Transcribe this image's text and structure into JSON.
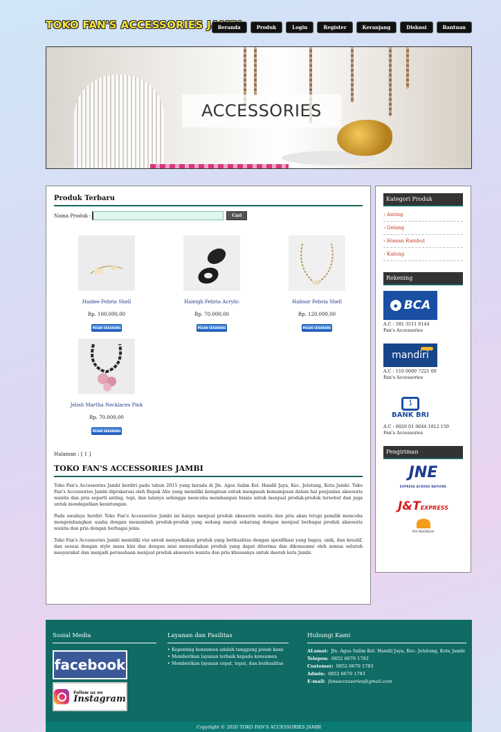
{
  "header": {
    "logo": "TOKO FAN'S ACCESSORIES JAMBI",
    "nav": [
      "Beranda",
      "Produk",
      "Login",
      "Register",
      "Keranjang",
      "Diskusi",
      "Bantuan"
    ]
  },
  "banner": {
    "text": "ACCESSORIES"
  },
  "products_section": {
    "title": "Produk Terbaru",
    "search_label": "Nama Produk :",
    "search_value": "",
    "search_button": "Cari",
    "order_label": "PESAN SEKARANG",
    "items": [
      {
        "name": "Haidee Febria Shell",
        "price": "Rp. 100.000,00",
        "image_icon": "shell-necklace-image"
      },
      {
        "name": "Haleigh Febria Acrylic",
        "price": "Rp. 70.000,00",
        "image_icon": "acrylic-earring-image"
      },
      {
        "name": "Halinor Febria Shell",
        "price": "Rp. 120.000,00",
        "image_icon": "shell-chain-image"
      },
      {
        "name": "Jelish Martha Necklaces Pink",
        "price": "Rp. 70.000,00",
        "image_icon": "pink-necklace-image"
      }
    ],
    "paging": "Halaman : [ 1 ]"
  },
  "about": {
    "title": "TOKO FAN'S ACCESSORIES JAMBI",
    "paragraphs": [
      "Toko Fan's Accessories Jambi berdiri pada tahun 2015 yang berada di Jln. Agus Salim Kel. Handil Jaya, Kec. Jelutung, Kota Jambi. Toko Fan's Accessories Jambi diprakarsai oleh Bapak Alie yang memiliki keinginan untuk mengasah kemampuan dalam hal penjualan aksesoris wanita dan pria seperti anting, topi, dan lainnya sehingga mencoba membangun bisnis untuk menjual produk-produk tersebut dan juga untuk mendapatkan keuntungan.",
      "Pada awalnya berdiri Toko Fan's Accessories Jambi ini hanya menjual produk aksesoris wanita dan pria akan tetapi pemilik mencoba mengembangkan usaha dengan menambah produk-produk yang sedang marak sekarang dengan menjual berbagai produk aksesoris wanita dan pria dengan berbagai jenis.",
      "Toko Fan's Accessories Jambi memiliki visi untuk menyediakan produk yang berkualitas dengan spesifikasi yang bagus, unik, dan kreatif, dan sesuai dengan style masa kini dan dengan misi menyediakan produk yang dapat diterima dan dikonsumsi oleh semua seluruh masyarakat dan menjadi perusahaan menjual produk aksesoris wanita dan pria khususnya untuk daerah kota Jambi."
    ]
  },
  "sidebar": {
    "kategori_title": "Kategori Produk",
    "kategori": [
      "Anting",
      "Gelang",
      "Hiasan Rambut",
      "Kalung"
    ],
    "rekening_title": "Rekening",
    "banks": [
      {
        "logo_text": "BCA",
        "line1": "A.C : 581 3511 6144",
        "line2": "Fan's Accessories"
      },
      {
        "logo_text": "mandiri",
        "line1": "A.C : 110 0000 7221 00",
        "line2": "Fan's Accessories"
      },
      {
        "logo_text": "BANK BRI",
        "line1": "A.C : 0020 01 0644 1812 150",
        "line2": "Fan's Accessories"
      }
    ],
    "pengiriman_title": "Pengiriman",
    "couriers": {
      "jne": "JNE",
      "jne_tagline": "EXPRESS ACROSS NATIONS",
      "jt": "J&T",
      "jt_suffix": "EXPRESS",
      "pos": "POS INDONESIA"
    }
  },
  "footer": {
    "social_title": "Sosial Media",
    "facebook": "facebook",
    "instagram_top": "Follow us on",
    "instagram": "Instagram",
    "services_title": "Layanan dan Fasilitas",
    "services": [
      "Kepenting konsumen adalah tanggung jawab kami",
      "Memberikan layanan terbaik kepada konsumen",
      "Memberikan layanan cepat, tepat, dan berkualitas"
    ],
    "contact_title": "Hubungi Kami",
    "contact": {
      "alamat_label": "ALamat:",
      "alamat": "Jln. Agus Salim Kel. Handil Jaya, Kec. Jelutung, Kota Jambi",
      "telepon_label": "Telepon:",
      "telepon": "0852 6670 1783",
      "customer_label": "Customer:",
      "customer": "0852 6670 1783",
      "admin_label": "Admin:",
      "admin": "0852 6670 1783",
      "email_label": "E-mail:",
      "email": "fansaccessories@gmail.com"
    },
    "copyright": "Copyright © 2020 TOKO FAN'S ACCESSORIES JAMBI"
  }
}
